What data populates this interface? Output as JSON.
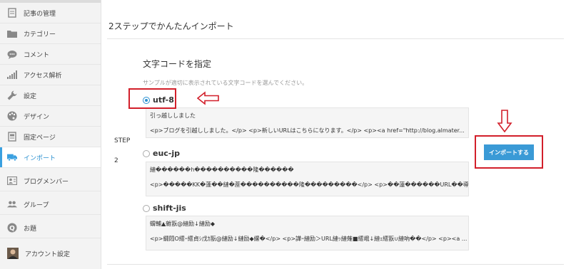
{
  "sidebar": {
    "items": [
      {
        "label": "記事の管理",
        "icon": "document-icon",
        "active": false
      },
      {
        "label": "カテゴリー",
        "icon": "folder-icon",
        "active": false
      },
      {
        "label": "コメント",
        "icon": "comment-icon",
        "active": false
      },
      {
        "label": "アクセス解析",
        "icon": "bar-chart-icon",
        "active": false
      },
      {
        "label": "設定",
        "icon": "wrench-icon",
        "active": false
      },
      {
        "label": "デザイン",
        "icon": "palette-icon",
        "active": false
      },
      {
        "label": "固定ページ",
        "icon": "page-icon",
        "active": false
      },
      {
        "label": "インポート",
        "icon": "truck-icon",
        "active": true
      },
      {
        "label": "ブログメンバー",
        "icon": "member-card-icon",
        "active": false
      },
      {
        "label": "グループ",
        "icon": "group-icon",
        "active": false
      },
      {
        "label": "お題",
        "icon": "topic-q-icon",
        "active": false
      },
      {
        "label": "アカウント設定",
        "icon": "avatar",
        "active": false
      }
    ]
  },
  "main": {
    "title": "2ステップでかんたんインポート",
    "section_title": "文字コードを指定",
    "hint": "サンプルが適切に表示されている文字コードを選んでください。",
    "step_label": "STEP",
    "step_number": "2",
    "encodings": [
      {
        "label": "utf-8",
        "checked": true,
        "preview_line1": "引っ越ししました",
        "preview_line2": "<p>ブログを引越ししました。</p> <p>新しいURLはこちらになります。</p> <p><a href=\"http://blog.almater..."
      },
      {
        "label": "euc-jp",
        "checked": false,
        "preview_line1": "縺������h����������隆������",
        "preview_line2": "<p>�����KK�蓬��縺�蓙����������隆���������</p> <p>��蓮������URL��導������..."
      },
      {
        "label": "shift-jis",
        "checked": false,
        "preview_line1": "蝟輔▲雜翫@縺励↓縺励◆",
        "preview_line2": "<p>繝悶Ο繧ｰ繧貞ｼ戊ｶ翫@縺励↓縺励◆縲�</p> <p>譁ｰ縺励＞URL縺ｯ縺薙■繧峨↓縺ｪ繧翫∪縺吶��</p> <p><a ..."
      }
    ],
    "import_button": "インポートする"
  },
  "colors": {
    "accent": "#3a9ad6",
    "annotation_red": "#d21f2a",
    "sidebar_bg": "#f3f3f3"
  }
}
